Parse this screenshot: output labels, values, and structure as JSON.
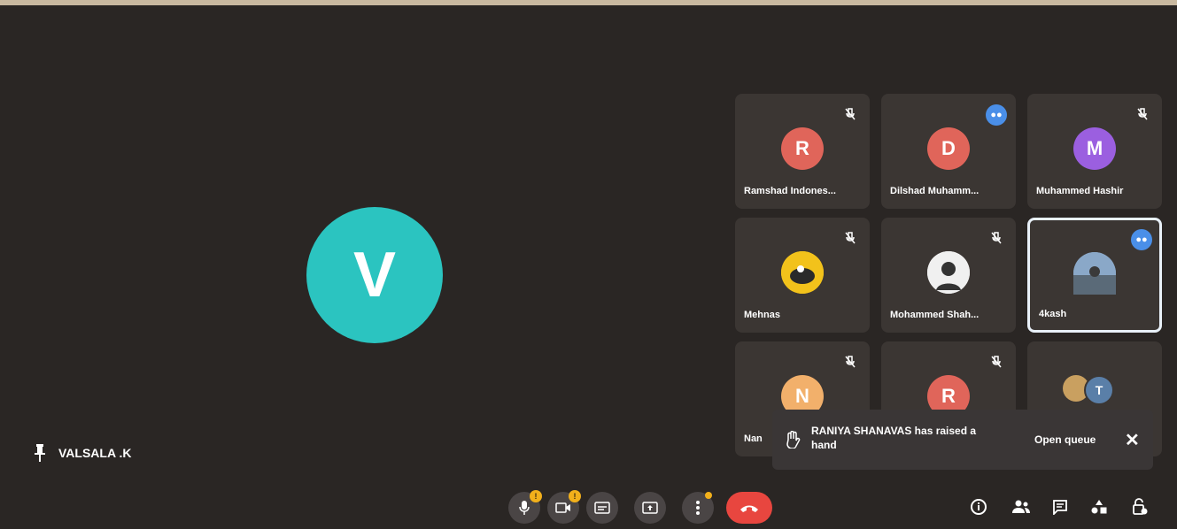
{
  "main": {
    "avatar_letter": "V",
    "avatar_color": "#2bc4c0",
    "pinned_name": "VALSALA .K"
  },
  "tiles": [
    {
      "name": "Ramshad Indones...",
      "letter": "R",
      "color": "#e0655a",
      "status": "muted"
    },
    {
      "name": "Dilshad Muhamm...",
      "letter": "D",
      "color": "#e0655a",
      "status": "speaking"
    },
    {
      "name": "Muhammed Hashir",
      "letter": "M",
      "color": "#9b5fe0",
      "status": "muted"
    },
    {
      "name": "Mehnas",
      "letter": "",
      "color": "#f2c21b",
      "status": "muted"
    },
    {
      "name": "Mohammed Shah...",
      "letter": "",
      "color": "#f0f0f0",
      "status": "muted"
    },
    {
      "name": "4kash",
      "letter": "",
      "color": "#8aa8c8",
      "status": "speaking"
    },
    {
      "name": "Nan",
      "letter": "N",
      "color": "#f2b06b",
      "status": "muted"
    },
    {
      "name": "",
      "letter": "R",
      "color": "#e0655a",
      "status": "muted"
    },
    {
      "name": "",
      "letter": "T",
      "color": "#5a7fa8",
      "status": "none"
    }
  ],
  "toast": {
    "message": "RANIYA SHANAVAS has raised a hand",
    "action": "Open queue",
    "close": "✕"
  },
  "toolbar": {
    "mic_badge": "!",
    "cam_badge": "!",
    "end_color": "#e8463f"
  },
  "icons": [
    "pin-icon",
    "mic-icon",
    "camera-icon",
    "captions-icon",
    "present-icon",
    "more-icon",
    "end-call-icon",
    "info-icon",
    "people-icon",
    "chat-icon",
    "activities-icon",
    "host-controls-icon",
    "raise-hand-icon",
    "mute-icon"
  ]
}
